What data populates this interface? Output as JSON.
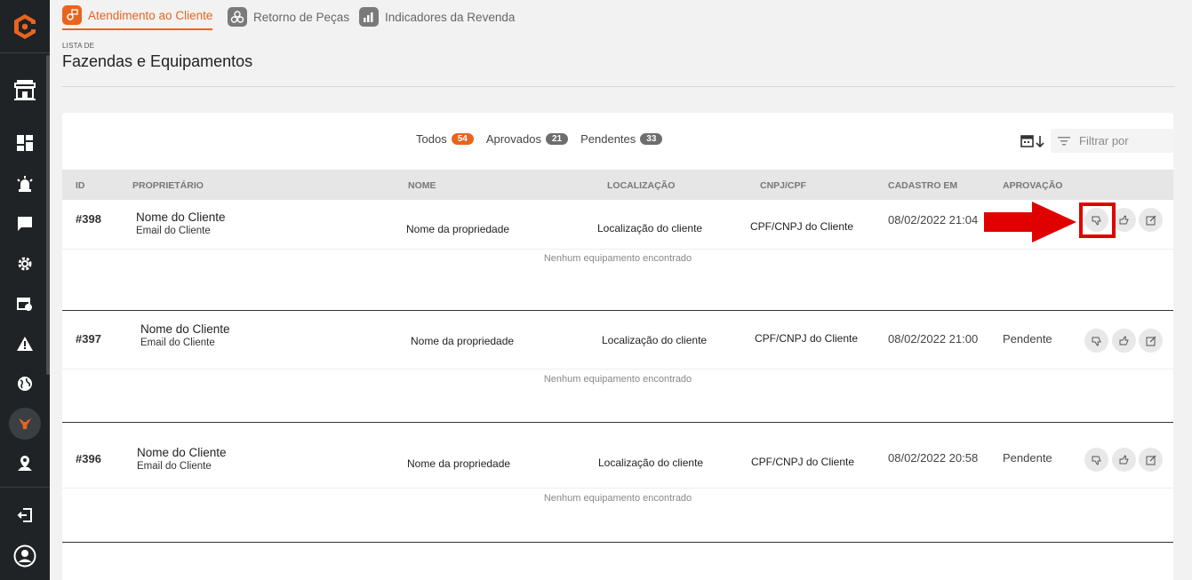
{
  "nav": {
    "tabs": [
      {
        "label": "Atendimento ao Cliente",
        "icon": "customer-service-icon",
        "active": true
      },
      {
        "label": "Retorno de Peças",
        "icon": "parts-return-icon",
        "active": false
      },
      {
        "label": "Indicadores da Revenda",
        "icon": "bar-chart-icon",
        "active": false
      }
    ]
  },
  "header": {
    "small_label": "LISTA DE",
    "title": "Fazendas e Equipamentos"
  },
  "filters": {
    "all_label": "Todos",
    "all_count": "54",
    "approved_label": "Aprovados",
    "approved_count": "21",
    "pending_label": "Pendentes",
    "pending_count": "33",
    "filter_placeholder": "Filtrar por"
  },
  "table": {
    "headers": {
      "id": "ID",
      "owner": "PROPRIETÁRIO",
      "name": "NOME",
      "location": "LOCALIZAÇÃO",
      "doc": "CNPJ/CPF",
      "created": "CADASTRO EM",
      "approval": "APROVAÇÃO"
    },
    "rows": [
      {
        "id": "#398",
        "owner": "Nome do Cliente",
        "email": "Email do Cliente",
        "name": "Nome da propriedade",
        "location": "Localização do cliente",
        "doc": "CPF/CNPJ do Cliente",
        "created": "08/02/2022 21:04",
        "status": "",
        "empty": "Nenhum equipamento encontrado"
      },
      {
        "id": "#397",
        "owner": "Nome do Cliente",
        "email": "Email do Cliente",
        "name": "Nome da propriedade",
        "location": "Localização do cliente",
        "doc": "CPF/CNPJ do Cliente",
        "created": "08/02/2022 21:00",
        "status": "Pendente",
        "empty": "Nenhum equipamento encontrado"
      },
      {
        "id": "#396",
        "owner": "Nome do Cliente",
        "email": "Email do Cliente",
        "name": "Nome da propriedade",
        "location": "Localização do cliente",
        "doc": "CPF/CNPJ do Cliente",
        "created": "08/02/2022 20:58",
        "status": "Pendente",
        "empty": "Nenhum equipamento encontrado"
      }
    ]
  },
  "colors": {
    "accent": "#e8641e",
    "sidebar": "#1f2326",
    "annotation": "#e00000"
  }
}
